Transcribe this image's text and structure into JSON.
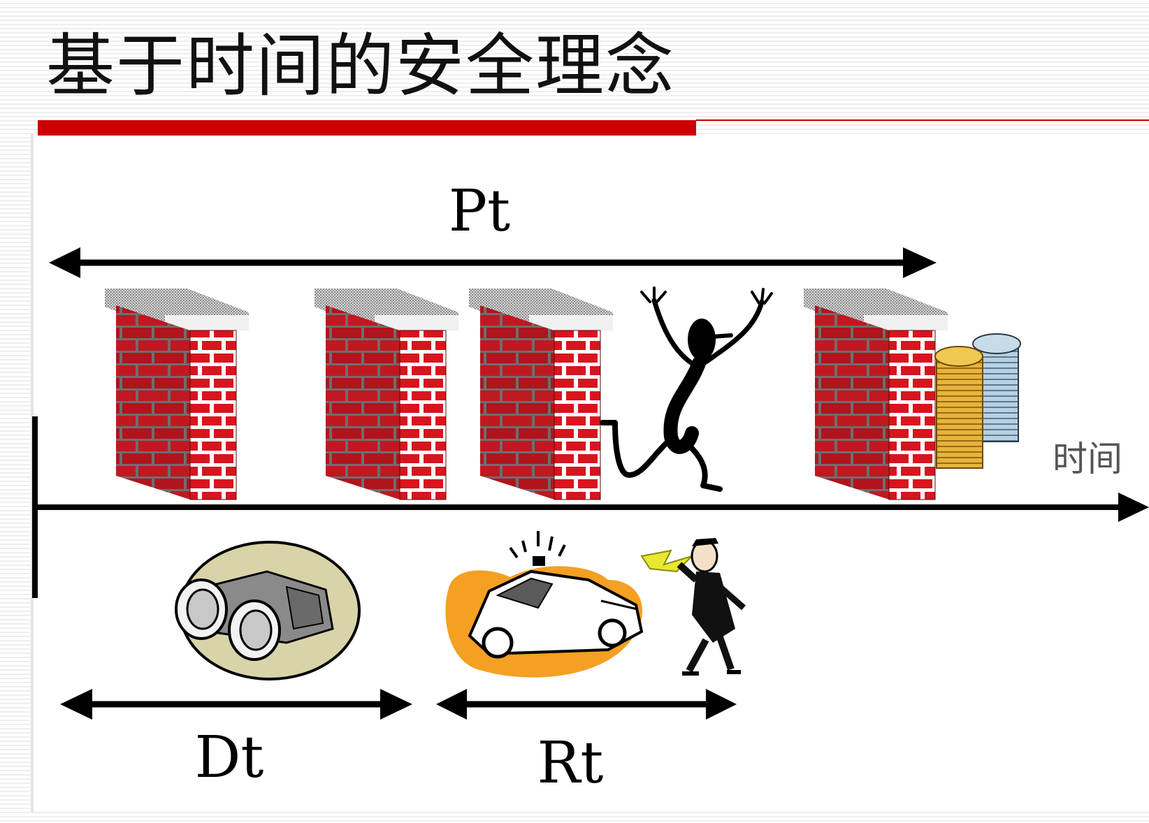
{
  "slide": {
    "title": "基于时间的安全理念",
    "accent_color": "#cc0000"
  },
  "diagram": {
    "labels": {
      "protection": "Pt",
      "detection": "Dt",
      "response": "Rt",
      "time_axis": "时间"
    },
    "illustrations": [
      "brick-wall",
      "brick-wall",
      "brick-wall",
      "intruder-figure",
      "brick-wall",
      "coin-stacks",
      "binoculars",
      "police-car",
      "police-officer-whistle"
    ],
    "colors": {
      "brick": "#d8141e",
      "brick_dark": "#7a1414",
      "mortar": "#ffffff",
      "wall_cap": "#c8c8c8",
      "ink": "#000000",
      "coin_gold": "#e6b43c",
      "coin_blue": "#a8c4d8",
      "binocular_bg": "#d8d4a8",
      "police_splash": "#f4a023"
    }
  }
}
